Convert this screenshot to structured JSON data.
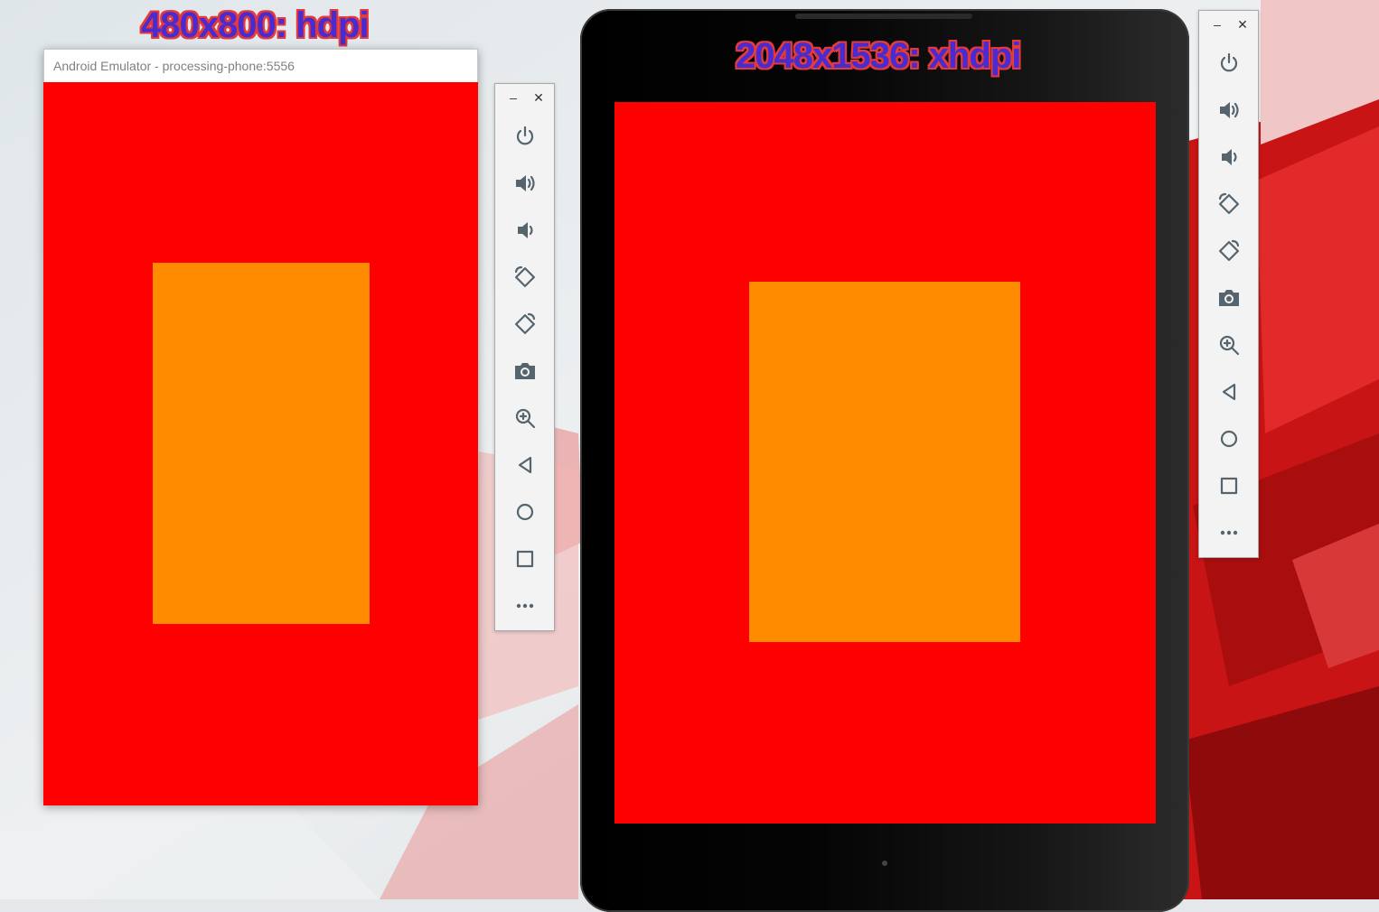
{
  "labels": {
    "phone_resolution": "480x800: hdpi",
    "tablet_resolution": "2048x1536: xhdpi"
  },
  "phone_window": {
    "title": "Android Emulator - processing-phone:5556"
  },
  "colors": {
    "screen_background": "#ff0000",
    "rectangle_fill": "#ff8c00",
    "label_text": "#4a2bd0",
    "label_outline": "#e33a3a"
  },
  "toolbar": {
    "window_minimize": "–",
    "window_close": "✕",
    "buttons": [
      "power-icon",
      "volume-up-icon",
      "volume-down-icon",
      "rotate-left-icon",
      "rotate-right-icon",
      "camera-icon",
      "zoom-icon",
      "back-icon",
      "home-icon",
      "overview-icon",
      "more-icon"
    ]
  }
}
